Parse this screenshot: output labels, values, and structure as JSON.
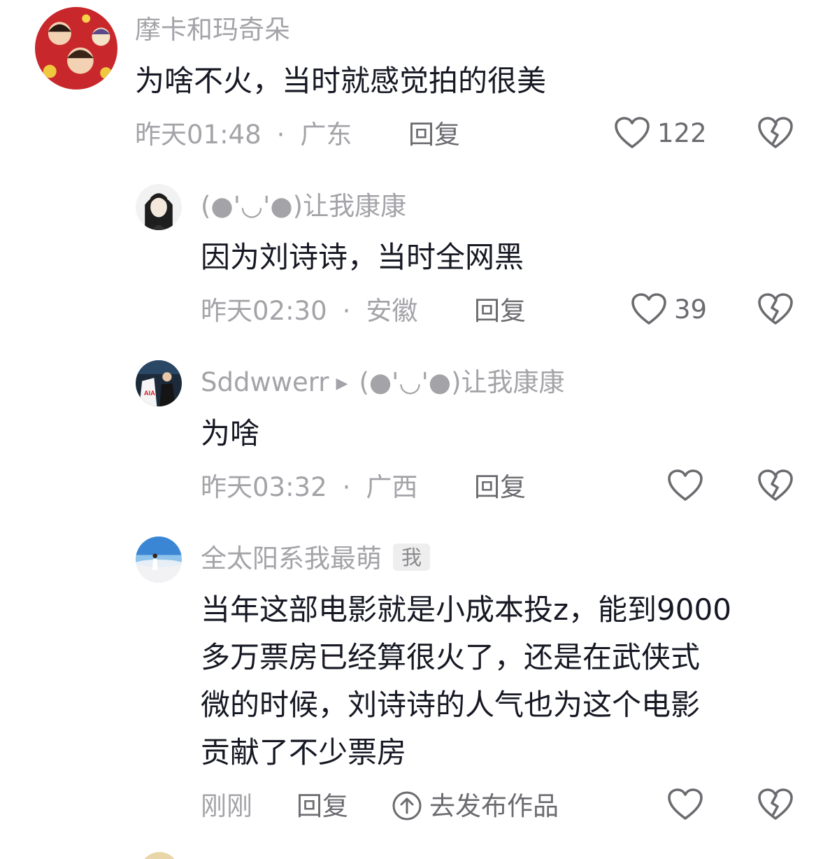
{
  "comments": [
    {
      "username": "摩卡和玛奇朵",
      "text": "为啥不火，当时就感觉拍的很美",
      "time": "昨天01:48",
      "separator": "·",
      "location": "广东",
      "reply_label": "回复",
      "likes": "122",
      "avatar_icon": "cartoon-avatar"
    },
    {
      "username": "(●'◡'●)让我康康",
      "text": "因为刘诗诗，当时全网黑",
      "time": "昨天02:30",
      "separator": "·",
      "location": "安徽",
      "reply_label": "回复",
      "likes": "39",
      "avatar_icon": "anime-portrait-avatar"
    },
    {
      "username": "Sddwwerr",
      "reply_arrow": "▶",
      "reply_to": "(●'◡'●)让我康康",
      "text": "为啥",
      "time": "昨天03:32",
      "separator": "·",
      "location": "广西",
      "reply_label": "回复",
      "likes": "",
      "avatar_icon": "jersey-photo-avatar"
    },
    {
      "username": "全太阳系我最萌",
      "badge": "我",
      "text_lines": [
        "当年这部电影就是小成本投z，能到9000",
        "多万票房已经算很火了，还是在武侠式",
        "微的时候，刘诗诗的人气也为这个电影",
        "贡献了不少票房"
      ],
      "time": "刚刚",
      "reply_label": "回复",
      "publish_label": "去发布作品",
      "likes": "",
      "avatar_icon": "beach-photo-avatar"
    }
  ],
  "icons": {
    "like": "heart-outline-icon",
    "dislike": "broken-heart-icon",
    "publish": "upload-circle-icon"
  },
  "colors": {
    "text": "#161823",
    "meta": "#a3a3a8",
    "action": "#6b6b70",
    "badge_bg": "#eeeeee"
  }
}
